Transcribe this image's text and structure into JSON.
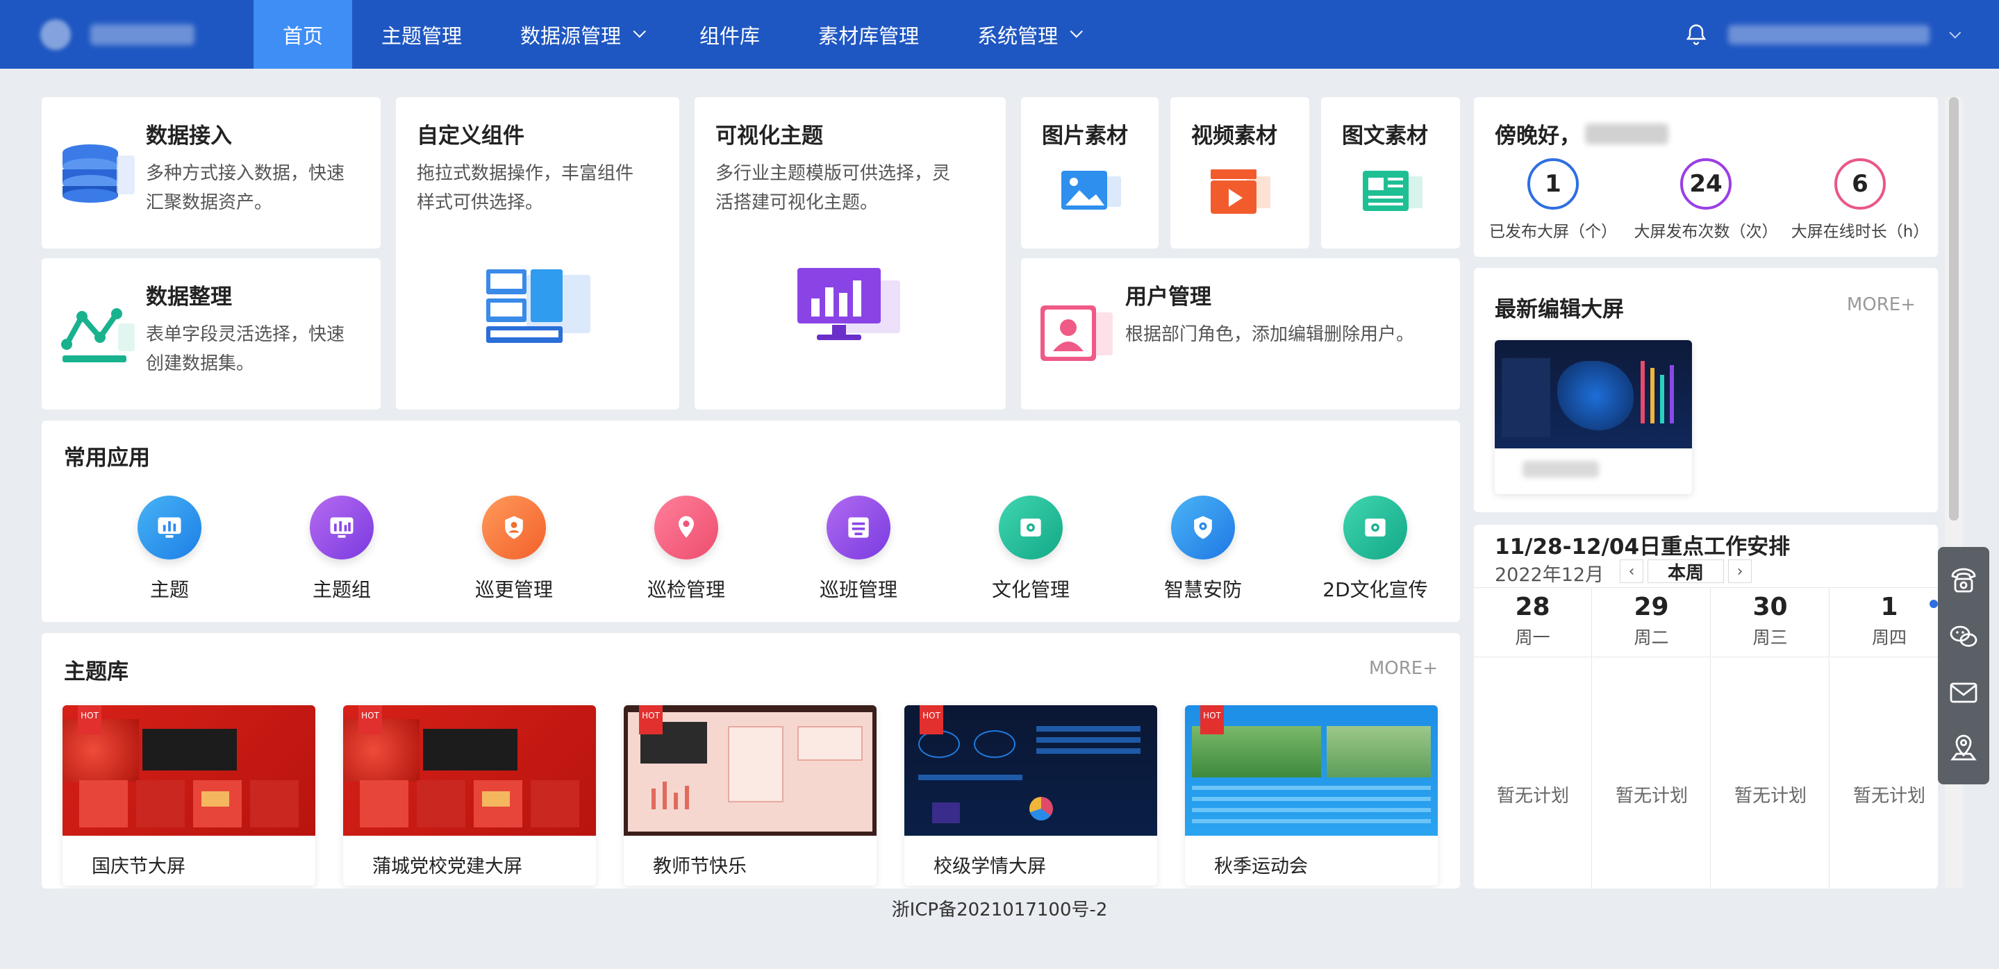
{
  "nav": {
    "items": [
      {
        "label": "首页",
        "active": true
      },
      {
        "label": "主题管理"
      },
      {
        "label": "数据源管理",
        "dropdown": true
      },
      {
        "label": "组件库"
      },
      {
        "label": "素材库管理"
      },
      {
        "label": "系统管理",
        "dropdown": true
      }
    ]
  },
  "features": {
    "data_access": {
      "title": "数据接入",
      "desc1": "多种方式接入数据，快速",
      "desc2": "汇聚数据资产。"
    },
    "data_clean": {
      "title": "数据整理",
      "desc1": "表单字段灵活选择，快速",
      "desc2": "创建数据集。"
    },
    "custom_comp": {
      "title": "自定义组件",
      "desc1": "拖拉式数据操作，丰富组件",
      "desc2": "样式可供选择。"
    },
    "vis_theme": {
      "title": "可视化主题",
      "desc1": "多行业主题模版可供选择，灵",
      "desc2": "活搭建可视化主题。"
    },
    "img_mat": {
      "title": "图片素材"
    },
    "video_mat": {
      "title": "视频素材"
    },
    "text_mat": {
      "title": "图文素材"
    },
    "user_mgmt": {
      "title": "用户管理",
      "desc": "根据部门角色，添加编辑删除用户。"
    }
  },
  "apps": {
    "title": "常用应用",
    "items": [
      {
        "label": "主题"
      },
      {
        "label": "主题组"
      },
      {
        "label": "巡更管理"
      },
      {
        "label": "巡检管理"
      },
      {
        "label": "巡班管理"
      },
      {
        "label": "文化管理"
      },
      {
        "label": "智慧安防"
      },
      {
        "label": "2D文化宣传"
      }
    ]
  },
  "library": {
    "title": "主题库",
    "more": "MORE+",
    "hot": "HOT",
    "items": [
      {
        "label": "国庆节大屏"
      },
      {
        "label": "蒲城党校党建大屏"
      },
      {
        "label": "教师节快乐"
      },
      {
        "label": "校级学情大屏"
      },
      {
        "label": "秋季运动会"
      }
    ]
  },
  "greeting": {
    "text": "傍晚好，",
    "stats": [
      {
        "value": "1",
        "label": "已发布大屏（个）",
        "color": "#2f6fe0"
      },
      {
        "value": "24",
        "label": "大屏发布次数（次）",
        "color": "#9a3ee6"
      },
      {
        "value": "6",
        "label": "大屏在线时长（h）",
        "color": "#e8578a"
      }
    ]
  },
  "recent": {
    "title": "最新编辑大屏",
    "more": "MORE+"
  },
  "schedule": {
    "title": "11/28-12/04日重点工作安排",
    "month": "2022年12月",
    "this_week": "本周",
    "days": [
      {
        "num": "28",
        "weekday": "周一",
        "plan": "暂无计划"
      },
      {
        "num": "29",
        "weekday": "周二",
        "plan": "暂无计划"
      },
      {
        "num": "30",
        "weekday": "周三",
        "plan": "暂无计划"
      },
      {
        "num": "1",
        "weekday": "周四",
        "plan": "暂无计划"
      }
    ]
  },
  "footer": {
    "icp": "浙ICP备2021017100号-2"
  }
}
